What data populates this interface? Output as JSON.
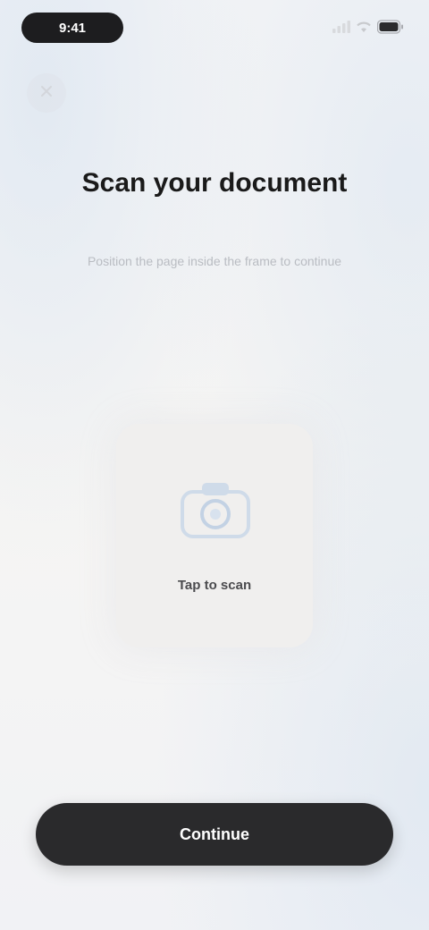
{
  "status_bar": {
    "time": "9:41",
    "icons": [
      "signal-icon",
      "wifi-icon",
      "battery-icon"
    ]
  },
  "header": {
    "close_icon": "close-icon",
    "title": "Scan your document",
    "subtitle": "Position the page inside the frame to continue"
  },
  "scan_card": {
    "icon": "camera-icon",
    "label": "Tap to scan"
  },
  "footer": {
    "primary_label": "Continue"
  },
  "colors": {
    "accent_dark": "#2a2a2c",
    "icon_tint": "#c9d6e6",
    "background": "#f4f4f4"
  }
}
